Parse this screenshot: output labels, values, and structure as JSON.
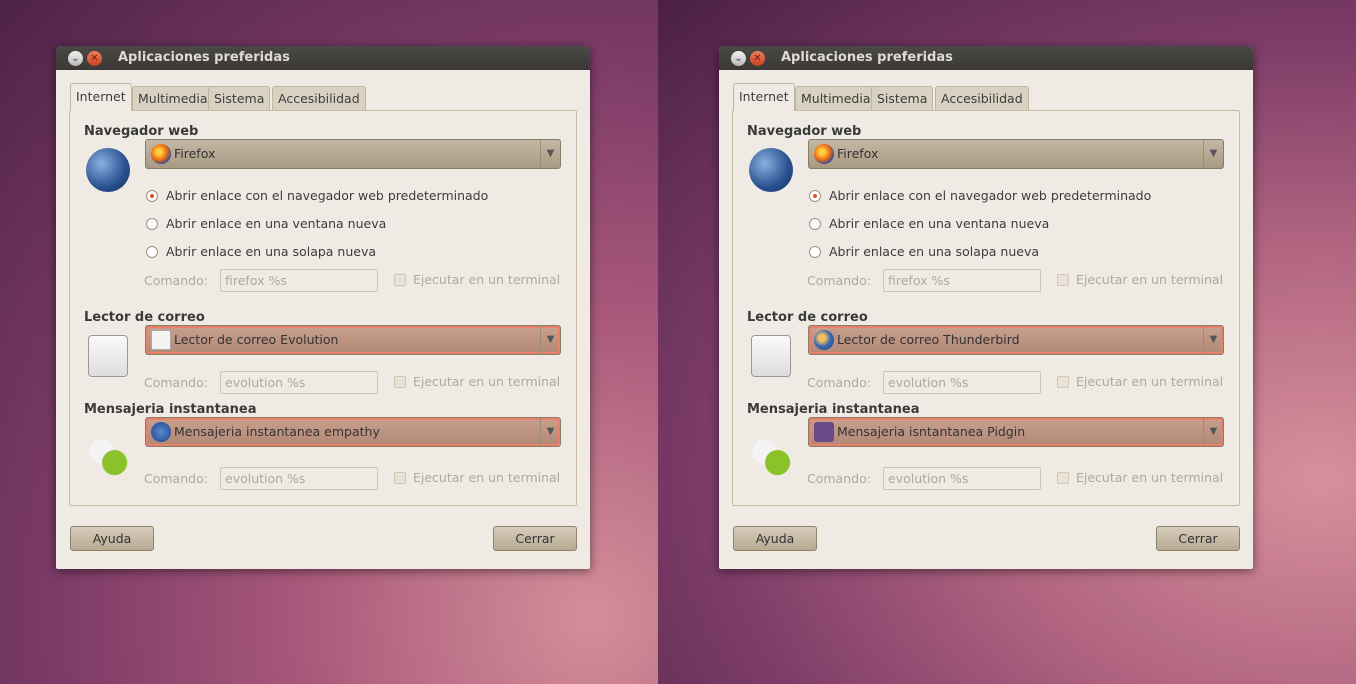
{
  "dialogs": [
    {
      "title": "Aplicaciones preferidas",
      "tabs": [
        "Internet",
        "Multimedia",
        "Sistema",
        "Accesibilidad"
      ],
      "web": {
        "heading": "Navegador web",
        "browser": "Firefox",
        "radios": [
          "Abrir enlace con el navegador web predeterminado",
          "Abrir enlace en una ventana nueva",
          "Abrir enlace en una solapa nueva"
        ],
        "command_label": "Comando:",
        "command": "firefox %s",
        "terminal": "Ejecutar en un terminal"
      },
      "mail": {
        "heading": "Lector de correo",
        "client": "Lector de correo Evolution",
        "command_label": "Comando:",
        "command": "evolution %s",
        "terminal": "Ejecutar en un terminal"
      },
      "im": {
        "heading": "Mensajeria instantanea",
        "client": "Mensajeria instantanea empathy",
        "command_label": "Comando:",
        "command": "evolution %s",
        "terminal": "Ejecutar en un terminal"
      },
      "help": "Ayuda",
      "close": "Cerrar",
      "mail_icon": "envelope-icon",
      "im_icon": "empathy-icon"
    },
    {
      "title": "Aplicaciones preferidas",
      "tabs": [
        "Internet",
        "Multimedia",
        "Sistema",
        "Accesibilidad"
      ],
      "web": {
        "heading": "Navegador web",
        "browser": "Firefox",
        "radios": [
          "Abrir enlace con el navegador web predeterminado",
          "Abrir enlace en una ventana nueva",
          "Abrir enlace en una solapa nueva"
        ],
        "command_label": "Comando:",
        "command": "firefox %s",
        "terminal": "Ejecutar en un terminal"
      },
      "mail": {
        "heading": "Lector de correo",
        "client": "Lector de correo Thunderbird",
        "command_label": "Comando:",
        "command": "evolution %s",
        "terminal": "Ejecutar en un terminal"
      },
      "im": {
        "heading": "Mensajeria instantanea",
        "client": "Mensajeria isntantanea Pidgin",
        "command_label": "Comando:",
        "command": "evolution %s",
        "terminal": "Ejecutar en un terminal"
      },
      "help": "Ayuda",
      "close": "Cerrar",
      "mail_icon": "thunderbird-icon",
      "im_icon": "pidgin-icon"
    }
  ]
}
